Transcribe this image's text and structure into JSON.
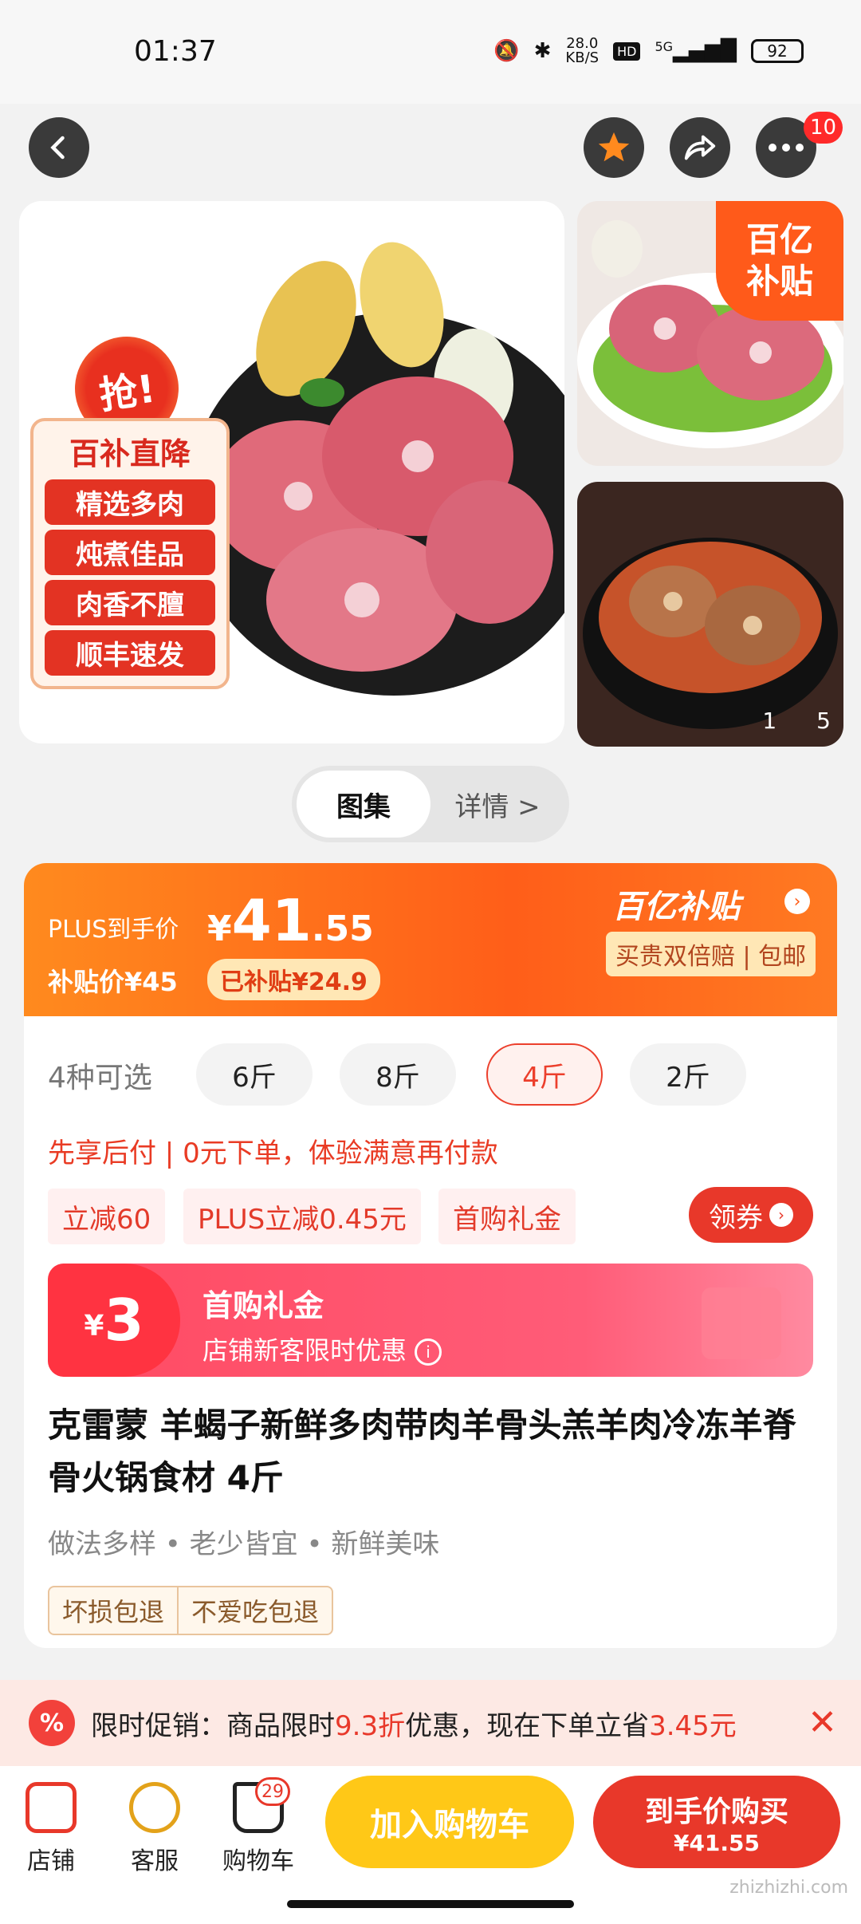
{
  "status": {
    "time": "01:37",
    "net_speed": "28.0",
    "net_unit": "KB/S",
    "hd": "HD",
    "signal": "5G",
    "battery": "92"
  },
  "topbar": {
    "msg_count": "10"
  },
  "gallery": {
    "qiang": "抢!",
    "promo_title": "百补直降",
    "promo_tags": [
      "精选多肉",
      "炖煮佳品",
      "肉香不膻",
      "顺丰速发"
    ],
    "corner_badge_line1": "百亿",
    "corner_badge_line2": "补贴",
    "page_current": "1",
    "page_total": "5"
  },
  "tabs": {
    "gallery": "图集",
    "detail": "详情 >"
  },
  "price": {
    "plus_label": "PLUS到手价",
    "plus_yen": "¥",
    "plus_int": "41",
    "plus_dec": ".55",
    "subsidy_label": "补贴价¥45",
    "subsidy_badge": "已补贴¥24.9",
    "logo": "百亿补贴",
    "guarantee": "买贵双倍赔 | 包邮"
  },
  "specs": {
    "label": "4种可选",
    "options": [
      "6斤",
      "8斤",
      "4斤",
      "2斤"
    ],
    "selected_index": 2
  },
  "pay_later": "先享后付 | 0元下单，体验满意再付款",
  "coupons": {
    "tags": [
      "立减60",
      "PLUS立减0.45元",
      "首购礼金"
    ],
    "claim": "领券"
  },
  "gift": {
    "yen": "¥",
    "amount": "3",
    "title": "首购礼金",
    "subtitle": "店铺新客限时优惠"
  },
  "product": {
    "title": "克雷蒙 羊蝎子新鲜多肉带肉羊骨头羔羊肉冷冻羊脊骨火锅食材 4斤",
    "features": "做法多样 • 老少皆宜 • 新鲜美味",
    "guarantees": [
      "坏损包退",
      "不爱吃包退"
    ]
  },
  "promo_bar": {
    "prefix": "限时促销：商品限时",
    "discount": "9.3折",
    "middle": "优惠，现在下单立省",
    "saving": "3.45元",
    "close": "✕"
  },
  "bottom": {
    "shop": "店铺",
    "service": "客服",
    "cart": "购物车",
    "cart_count": "29",
    "add_cart": "加入购物车",
    "buy_title": "到手价购买",
    "buy_price": "¥41.55"
  },
  "watermark": "zhizhizhi.com",
  "colors": {
    "accent": "#e8382a",
    "orange": "#ff5e19",
    "yellow": "#ffc817"
  }
}
